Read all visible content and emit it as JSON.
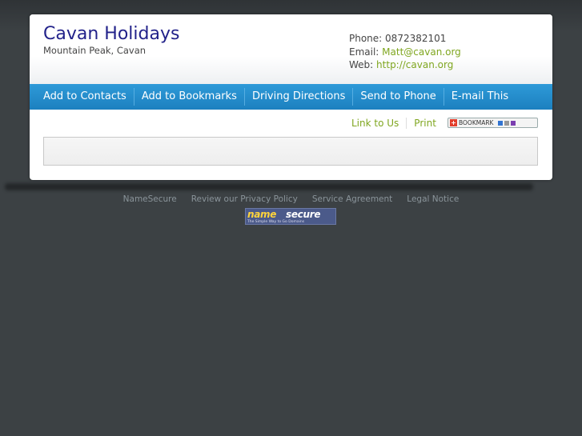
{
  "business": {
    "name": "Cavan Holidays",
    "location": "Mountain Peak, Cavan"
  },
  "contact": {
    "phone_label": "Phone:",
    "phone": "0872382101",
    "email_label": "Email:",
    "email": "Matt@cavan.org",
    "web_label": "Web:",
    "web": "http://cavan.org"
  },
  "nav": {
    "items": [
      "Add to Contacts",
      "Add to Bookmarks",
      "Driving Directions",
      "Send to Phone",
      "E-mail This"
    ]
  },
  "actions": {
    "link_to_us": "Link to Us",
    "print": "Print",
    "bookmark_label": "BOOKMARK"
  },
  "footer": {
    "links": [
      "NameSecure",
      "Review our Privacy Policy",
      "Service Agreement",
      "Legal Notice"
    ],
    "logo_name": "name",
    "logo_secure": "secure",
    "logo_tagline": "The Simple Way to Go Domains"
  },
  "colors": {
    "accent_link": "#7fa61f",
    "title": "#22228a",
    "nav_bar": "#2e9ad8",
    "background": "#3c4144"
  }
}
